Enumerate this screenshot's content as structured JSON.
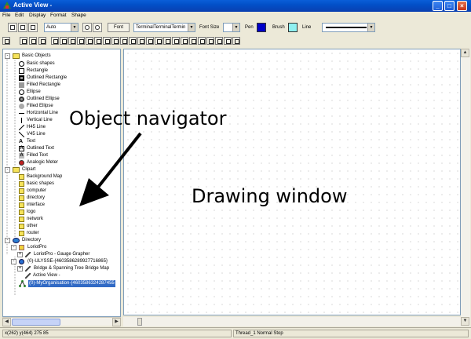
{
  "window": {
    "title": "Active View -"
  },
  "menu": [
    "File",
    "Edit",
    "Display",
    "Format",
    "Shape"
  ],
  "toolbar": {
    "zoom_value": "Auto",
    "font_button": "Font",
    "font_name": "TerminalTerminalTermin",
    "font_size_label": "Font Size",
    "font_size_value": "",
    "pen_label": "Pen",
    "pen_color": "#0000c8",
    "brush_label": "Brush",
    "brush_color": "#8ff0f0",
    "line_label": "Line"
  },
  "tree": {
    "basic_objects": {
      "label": "Basic Objects",
      "items": [
        "Basic shapes",
        "Rectangle",
        "Outlined Rectangle",
        "Filled Rectangle",
        "Ellipse",
        "Outlined Ellipse",
        "Filled Ellipse",
        "Horizontal Line",
        "Vertical Line",
        "H45 Line",
        "V45 Line",
        "Text",
        "Outlined Text",
        "Filled Text",
        "Analogic Meter"
      ]
    },
    "clipart": {
      "label": "Clipart",
      "items": [
        "Background Map",
        "basic shapes",
        "computer",
        "directory",
        "interface",
        "logo",
        "network",
        "other",
        "router"
      ]
    },
    "directory": {
      "label": "Directory",
      "items": [
        "LoriotPro",
        "LoriotPro - Gauge Grapher",
        "(0)-ULYSSE-{4603586289927716865}",
        "Bridge & Spanning Tree Bridge Map",
        "Active View -",
        "(0)-MyOrganisation-{4603586324287455"
      ]
    }
  },
  "annotations": {
    "navigator": "Object navigator",
    "drawing": "Drawing window"
  },
  "status": {
    "coords": "x(262) y(464) 275 85",
    "thread": "Thread_1 Normal Stop"
  }
}
